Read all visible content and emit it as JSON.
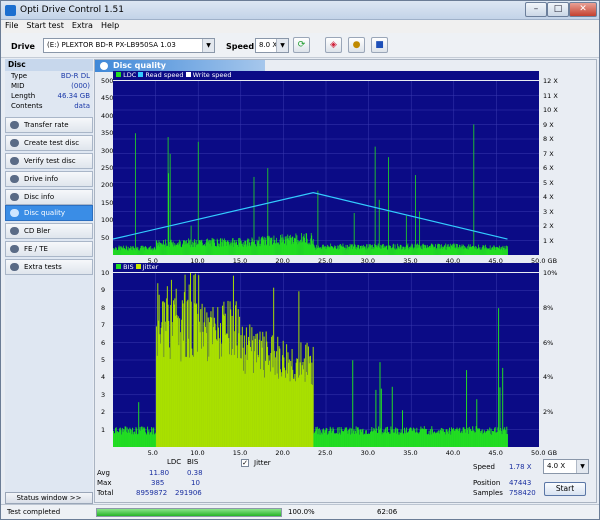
{
  "window": {
    "title": "Opti Drive Control 1.51",
    "min": "–",
    "max": "□",
    "close": "✕"
  },
  "menu": [
    "File",
    "Start test",
    "Extra",
    "Help"
  ],
  "toolbar": {
    "drive_label": "Drive",
    "drive_value": "(E:)  PLEXTOR BD-R  PX-LB950SA 1.03",
    "speed_label": "Speed",
    "speed_value": "8.0 X"
  },
  "disc": {
    "header": "Disc",
    "rows": [
      {
        "k": "Type",
        "v": "BD-R DL"
      },
      {
        "k": "MID",
        "v": "(000)"
      },
      {
        "k": "Length",
        "v": "46.34 GB"
      },
      {
        "k": "Contents",
        "v": "data"
      }
    ]
  },
  "nav": [
    "Transfer rate",
    "Create test disc",
    "Verify test disc",
    "Drive info",
    "Disc info",
    "Disc quality",
    "CD Bler",
    "FE / TE",
    "Extra tests"
  ],
  "nav_selected": "Disc quality",
  "status_window_button": "Status window >>",
  "panel_title": "Disc quality",
  "legend_top": {
    "a": "LDC",
    "b": "Read speed",
    "c": "Write speed"
  },
  "legend_bottom": {
    "a": "BIS",
    "b": "Jitter"
  },
  "stats": {
    "col1": "LDC",
    "col2": "BIS",
    "avg_label": "Avg",
    "avg_ldc": "11.80",
    "avg_bis": "0.38",
    "max_label": "Max",
    "max_ldc": "385",
    "max_bis": "10",
    "total_label": "Total",
    "total_ldc": "8959872",
    "total_bis": "291906"
  },
  "jitter": {
    "checked": "✓",
    "label": "Jitter"
  },
  "right": {
    "speed_label": "Speed",
    "speed_value": "1.78 X",
    "speed_combo": "4.0 X",
    "position_label": "Position",
    "position_value": "47443",
    "samples_label": "Samples",
    "samples_value": "758420",
    "start": "Start"
  },
  "statusbar": {
    "text": "Test completed",
    "percent": "100.0%",
    "time": "62:06"
  },
  "colors": {
    "plot_bg": "#0b0b86",
    "ldc": "#22dd22",
    "speed": "#33ccff",
    "bis": "#22dd22",
    "jitter": "#c8e600"
  },
  "chart_data": [
    {
      "type": "bar",
      "series": [
        {
          "name": "LDC",
          "values": "noisy profile"
        },
        {
          "name": "Read speed"
        },
        {
          "name": "Write speed"
        }
      ],
      "xlim": [
        0,
        50
      ],
      "xticks": [
        "5.0",
        "10.0",
        "15.0",
        "20.0",
        "25.0",
        "30.0",
        "35.0",
        "40.0",
        "45.0",
        "50.0 GB"
      ],
      "yticks_left": [
        "50",
        "100",
        "150",
        "200",
        "250",
        "300",
        "350",
        "400",
        "450",
        "500"
      ],
      "yticks_right": [
        "1 X",
        "2 X",
        "3 X",
        "4 X",
        "5 X",
        "6 X",
        "7 X",
        "8 X",
        "9 X",
        "10 X",
        "11 X",
        "12 X"
      ],
      "ldc_profile": [
        [
          0,
          25
        ],
        [
          5,
          25
        ],
        [
          5,
          40
        ],
        [
          10,
          45
        ],
        [
          15,
          45
        ],
        [
          20,
          55
        ],
        [
          23.5,
          60
        ],
        [
          23.5,
          30
        ],
        [
          30,
          30
        ],
        [
          40,
          30
        ],
        [
          46.3,
          25
        ]
      ],
      "speed": [
        [
          0,
          1.1
        ],
        [
          23.5,
          4.3
        ],
        [
          46.3,
          1.1
        ]
      ]
    },
    {
      "type": "bar",
      "series": [
        {
          "name": "BIS"
        },
        {
          "name": "Jitter"
        }
      ],
      "xlim": [
        0,
        50
      ],
      "xticks": [
        "5.0",
        "10.0",
        "15.0",
        "20.0",
        "25.0",
        "30.0",
        "35.0",
        "40.0",
        "45.0",
        "50.0 GB"
      ],
      "yticks_left": [
        "1",
        "2",
        "3",
        "4",
        "5",
        "6",
        "7",
        "8",
        "9",
        "10"
      ],
      "yticks_right": [
        "2%",
        "4%",
        "6%",
        "8%",
        "10%"
      ],
      "bis_profile": [
        [
          0,
          1
        ],
        [
          5,
          1
        ],
        [
          5,
          7
        ],
        [
          15,
          7
        ],
        [
          15,
          6
        ],
        [
          23.5,
          5
        ],
        [
          23.5,
          1
        ],
        [
          46.3,
          1
        ]
      ]
    }
  ]
}
